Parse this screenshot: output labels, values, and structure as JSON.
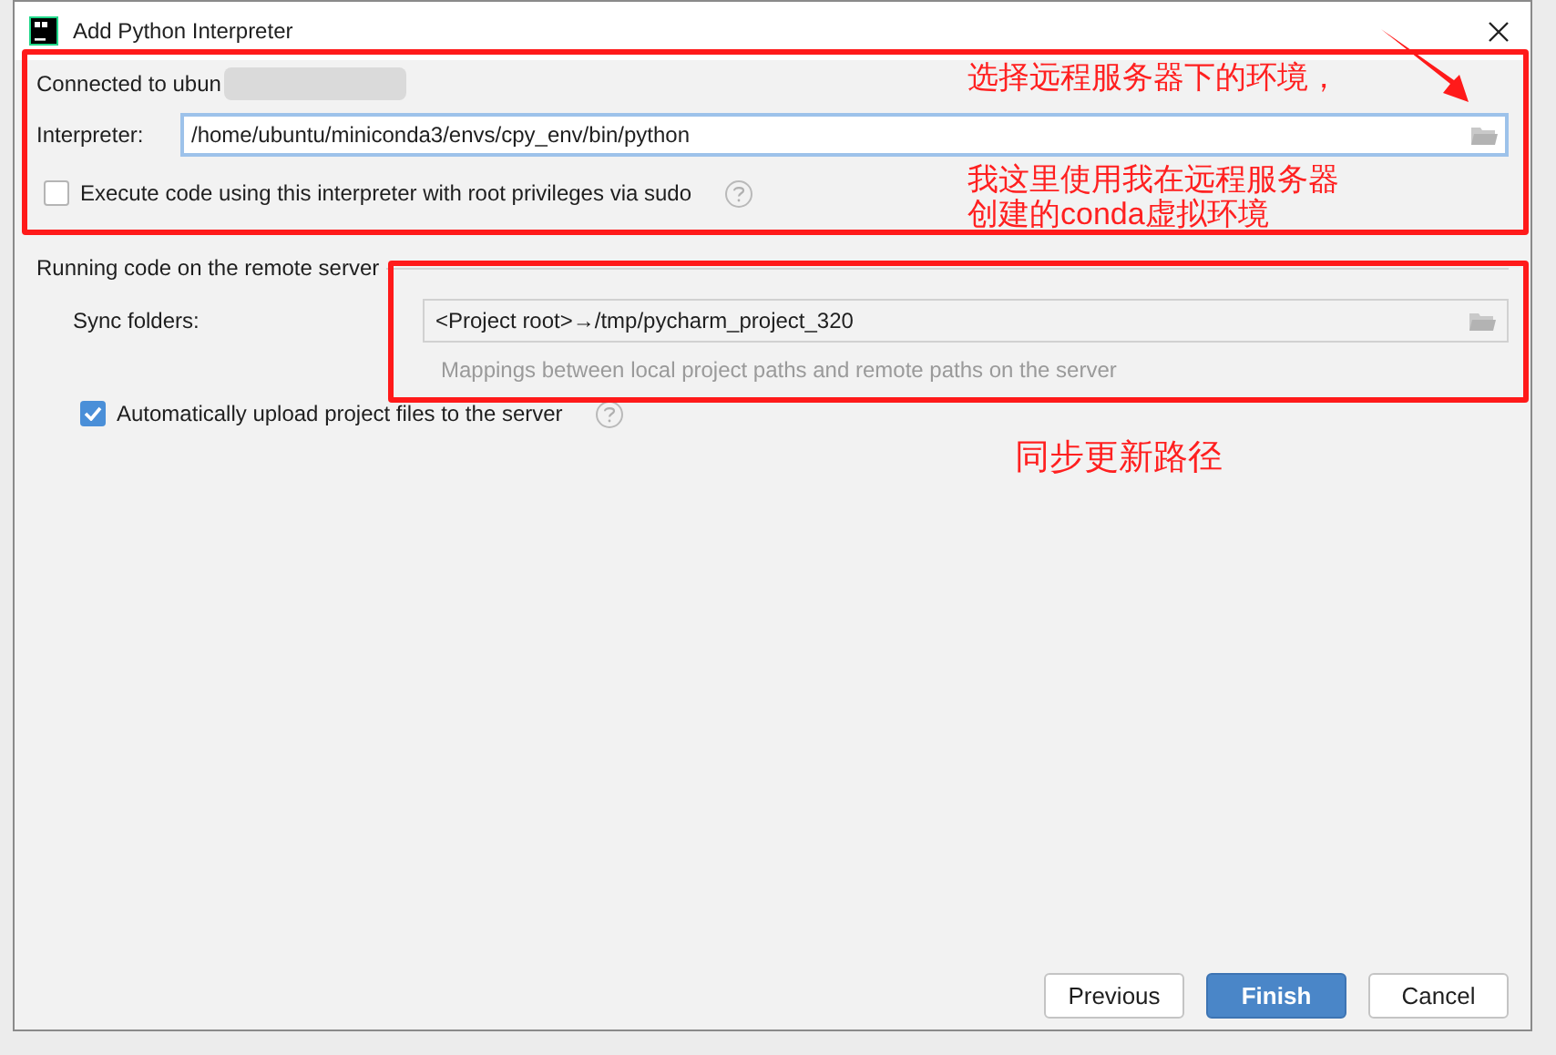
{
  "window": {
    "title": "Add Python Interpreter"
  },
  "connection": {
    "label": "Connected to ubun",
    "redacted": true
  },
  "interpreter": {
    "label": "Interpreter:",
    "value": "/home/ubuntu/miniconda3/envs/cpy_env/bin/python"
  },
  "sudo": {
    "label": "Execute code using this interpreter with root privileges via sudo",
    "checked": false
  },
  "section": {
    "title": "Running code on the remote server"
  },
  "sync": {
    "label": "Sync folders:",
    "value": "<Project root>→/tmp/pycharm_project_320",
    "hint": "Mappings between local project paths and remote paths on the server"
  },
  "auto_upload": {
    "label": "Automatically upload project files to the server",
    "checked": true
  },
  "buttons": [
    {
      "label": "Previous",
      "primary": false
    },
    {
      "label": "Finish",
      "primary": true
    },
    {
      "label": "Cancel",
      "primary": false
    }
  ],
  "annotations": [
    {
      "kind": "box",
      "lines": [
        "选择远程服务器下的环境，",
        "我这里使用我在远程服务器",
        "创建的conda虚拟环境"
      ]
    },
    {
      "kind": "box",
      "lines": [
        "同步更新路径"
      ]
    }
  ]
}
